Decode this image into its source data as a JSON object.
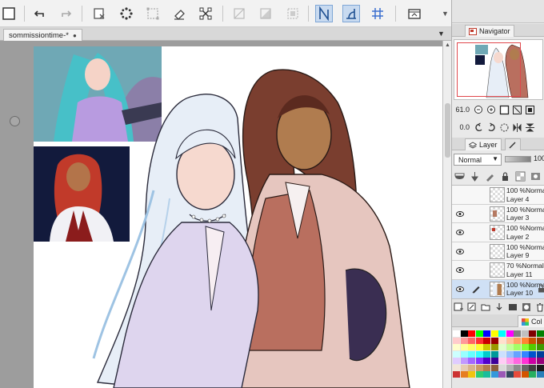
{
  "document": {
    "tab_title": "sommissiontime-*",
    "tab_close": "●"
  },
  "toolbar": {
    "icons": [
      "new-canvas",
      "undo",
      "redo",
      "clear",
      "fill-transparent",
      "select-all",
      "eraser",
      "transform",
      "hide-selection",
      "fill-selection",
      "invert-selection",
      "ruler-snap",
      "special-ruler-snap",
      "grid-snap"
    ],
    "overflow": "▼"
  },
  "navigator": {
    "tab_label": "Navigator",
    "zoom_value": "61.0",
    "rotation_value": "0.0"
  },
  "layer_panel": {
    "tab_label": "Layer",
    "blend_mode": "Normal",
    "opacity_value": "100",
    "layers": [
      {
        "opacity": "100 %",
        "mode": "Normal",
        "name": "Layer 4",
        "visible": false,
        "selected": false
      },
      {
        "opacity": "100 %",
        "mode": "Normal",
        "name": "Layer 3",
        "visible": true,
        "selected": false
      },
      {
        "opacity": "100 %",
        "mode": "Normal",
        "name": "Layer 2",
        "visible": true,
        "selected": false
      },
      {
        "opacity": "100 %",
        "mode": "Normal",
        "name": "Layer 9",
        "visible": true,
        "selected": false
      },
      {
        "opacity": "70 %",
        "mode": "Normal",
        "name": "Layer 11",
        "visible": true,
        "selected": false
      },
      {
        "opacity": "100 %",
        "mode": "Normal",
        "name": "Layer 10",
        "visible": true,
        "selected": true
      }
    ]
  },
  "color_set": {
    "tab_label": "Col",
    "colors": [
      "#ffffff",
      "#000000",
      "#ff0000",
      "#00ff00",
      "#0000ff",
      "#ffff00",
      "#00ffff",
      "#ff00ff",
      "#808080",
      "#c0c0c0",
      "#800000",
      "#008000",
      "#ffcccc",
      "#ff9999",
      "#ff6666",
      "#ff3333",
      "#cc0000",
      "#990000",
      "#ffe0cc",
      "#ffc299",
      "#ffa366",
      "#ff8533",
      "#cc5200",
      "#993d00",
      "#ffffcc",
      "#ffff99",
      "#ffff66",
      "#ffff33",
      "#cccc00",
      "#999900",
      "#e0ffcc",
      "#c2ff99",
      "#a3ff66",
      "#85ff33",
      "#52cc00",
      "#3d9900",
      "#ccffff",
      "#99ffff",
      "#66ffff",
      "#33ffff",
      "#00cccc",
      "#009999",
      "#cce0ff",
      "#99c2ff",
      "#66a3ff",
      "#3385ff",
      "#0052cc",
      "#003d99",
      "#e0ccff",
      "#c299ff",
      "#a366ff",
      "#8533ff",
      "#5200cc",
      "#3d0099",
      "#ffccf5",
      "#ff99eb",
      "#ff66e0",
      "#ff33d6",
      "#cc00a3",
      "#99007a",
      "#f2e6d9",
      "#e6ccb3",
      "#d9b38c",
      "#cc9966",
      "#b37a4d",
      "#8c5e3c",
      "#d9d9d9",
      "#b3b3b3",
      "#8c8c8c",
      "#666666",
      "#404040",
      "#1a1a1a",
      "#cc3333",
      "#e67e22",
      "#f1c40f",
      "#2ecc71",
      "#1abc9c",
      "#3498db",
      "#9b59b6",
      "#34495e",
      "#e74c3c",
      "#d35400",
      "#27ae60",
      "#2980b9"
    ]
  },
  "colors": {
    "accent": "#7ea6d6",
    "selection": "#cfe0f5",
    "nav_frame": "#e0474c"
  }
}
